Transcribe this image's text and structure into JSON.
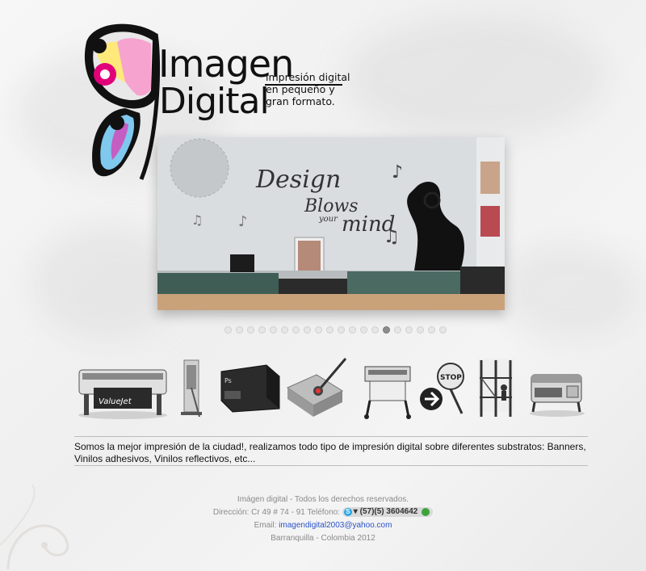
{
  "logo": {
    "word1": "Imagen",
    "word2": "Digital",
    "tagline_1": "impresión digital",
    "tagline_2": "en pequeño y",
    "tagline_3": "gran formato."
  },
  "slideshow": {
    "wall_text_1": "Design",
    "wall_text_2": "Blows",
    "wall_text_3": "your",
    "wall_text_4": "mind",
    "slide_count": 20,
    "active_index": 14
  },
  "thumbnails": [
    {
      "name": "large-format-printer",
      "label": "ValueJet"
    },
    {
      "name": "roll-up-banner",
      "label": ""
    },
    {
      "name": "dark-sign-board",
      "label": "Ps"
    },
    {
      "name": "vinyl-cutter-pen",
      "label": ""
    },
    {
      "name": "plotter-machine",
      "label": ""
    },
    {
      "name": "stop-sign",
      "label": "STOP"
    },
    {
      "name": "scaffold-install",
      "label": ""
    },
    {
      "name": "laminator-machine",
      "label": ""
    }
  ],
  "description": "Somos la mejor impresión de la ciudad!, realizamos todo tipo de impresión digital sobre diferentes substratos: Banners, Vinilos adhesivos, Vinilos reflectivos, etc...",
  "footer": {
    "rights": "Imágen digital - Todos los derechos reservados.",
    "address_label": "Dirección: Cr 49 # 74 - 91 Teléfono:",
    "skype_letter": "S",
    "phone": "(57)(5) 3604642",
    "email_label": "Email:",
    "email": "imagendigital2003@yahoo.com",
    "city": "Barranquilla - Colombia 2012"
  },
  "colors": {
    "magenta": "#e2007a",
    "cyan": "#00a3e0",
    "yellow": "#ffe600",
    "link": "#2a52c8"
  }
}
